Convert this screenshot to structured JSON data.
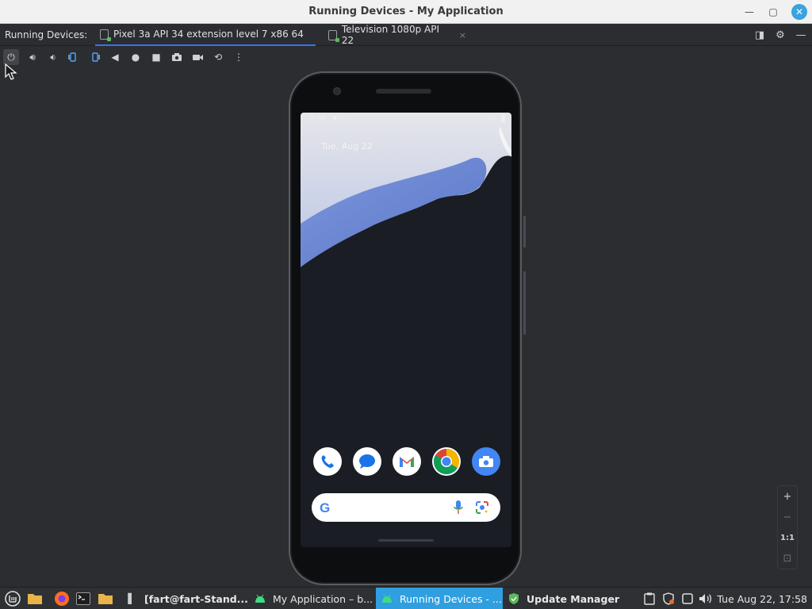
{
  "window": {
    "title": "Running Devices - My Application",
    "minimize": "—",
    "maximize": "▢",
    "close": "✕"
  },
  "tabbar": {
    "label": "Running Devices:",
    "tabs": [
      {
        "label": "Pixel 3a API 34 extension level 7 x86 64",
        "active": true
      },
      {
        "label": "Television 1080p API 22",
        "active": false
      }
    ],
    "close_glyph": "×"
  },
  "device": {
    "status_time": "5:56",
    "status_network": "3G",
    "date": "Tue, Aug 22",
    "dock_apps": [
      "phone",
      "messages",
      "gmail",
      "chrome",
      "camera"
    ],
    "search_logo": "G"
  },
  "zoom": {
    "zoom_in": "+",
    "zoom_out": "−",
    "actual_size": "1:1",
    "fit": "⊡"
  },
  "taskbar": {
    "items": [
      {
        "label": "[fart@fart-Stand...",
        "active": false
      },
      {
        "label": "My Application – b...",
        "active": false
      },
      {
        "label": "Running Devices - ...",
        "active": true
      },
      {
        "label": "Update Manager",
        "active": false
      }
    ],
    "clock": "Tue Aug 22, 17:58"
  },
  "colors": {
    "accent": "#3574f0",
    "taskbar_active": "#2f9fe0",
    "ide_bg": "#2b2d30"
  }
}
